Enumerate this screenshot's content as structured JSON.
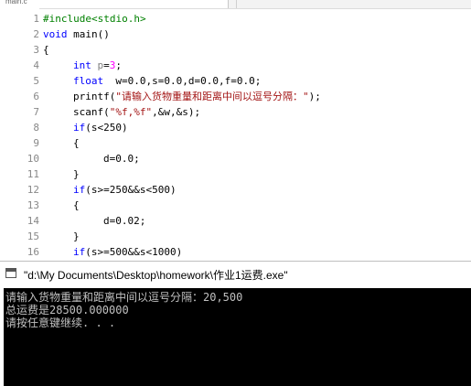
{
  "editor": {
    "tab_label": "main.c",
    "line_numbers": [
      "1",
      "2",
      "3",
      "4",
      "5",
      "6",
      "7",
      "8",
      "9",
      "10",
      "11",
      "12",
      "13",
      "14",
      "15",
      "16"
    ],
    "lines": {
      "l1": {
        "pp": "#include<stdio.h>"
      },
      "l2": {
        "kw": "void",
        "rest": " main()"
      },
      "l3": {
        "text": "{"
      },
      "l4": {
        "kw": "int",
        "var": "p",
        "eq": "=",
        "num": "3",
        "end": ";"
      },
      "l5": {
        "kw": "float",
        "text": "  w=0.0,s=0.0,d=0.0,f=0.0;"
      },
      "l6": {
        "fn": "printf(",
        "str": "\"请输入货物重量和距离中间以逗号分隔：\"",
        "end": ");"
      },
      "l7": {
        "fn": "scanf(",
        "str": "\"%f,%f\"",
        "end": ",&w,&s);"
      },
      "l8": {
        "kw": "if",
        "text": "(s<250)"
      },
      "l9": {
        "text": "{"
      },
      "l10": {
        "text": "d=0.0;"
      },
      "l11": {
        "text": "}"
      },
      "l12": {
        "kw": "if",
        "text": "(s>=250&&s<500)"
      },
      "l13": {
        "text": "{"
      },
      "l14": {
        "text": "d=0.02;"
      },
      "l15": {
        "text": "}"
      },
      "l16": {
        "kw": "if",
        "text": "(s>=500&&s<1000)"
      }
    }
  },
  "console": {
    "title": "\"d:\\My Documents\\Desktop\\homework\\作业1运费.exe\"",
    "output": [
      "请输入货物重量和距离中间以逗号分隔：20,500",
      "总运费是28500.000000",
      "请按任意键继续. . ."
    ]
  }
}
